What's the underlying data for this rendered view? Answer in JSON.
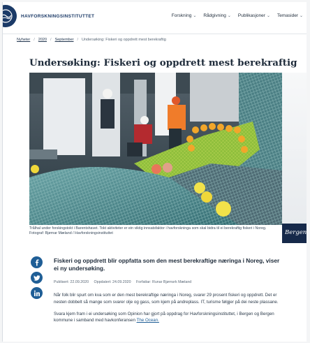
{
  "header": {
    "brand": "HAVFORSKNINGSINSTITUTTET",
    "nav": [
      {
        "label": "Forskning"
      },
      {
        "label": "Rådgivning"
      },
      {
        "label": "Publikasjoner"
      },
      {
        "label": "Temasider"
      }
    ]
  },
  "breadcrumb": {
    "items": [
      "Nyheter",
      "2020",
      "September"
    ],
    "current": "Undersøking: Fiskeri og oppdrett mest berekraftig"
  },
  "article": {
    "title": "Undersøking: Fiskeri og oppdrett mest berekraftig",
    "caption": "Trålhal under forskingstokt i Barentshavet. Tokt aktiviteter er ein viktig innsatsfaktor i havforskninga som skal bidra til ei berekraftig fiskeri i Noreg.",
    "photo_credit": "Fotograf: Bjørnar Mæland / Havforskningsinstituttet",
    "lead": "Fiskeri og oppdrett blir oppfatta som den mest berekraftige næringa i Noreg, viser ei ny undersøking.",
    "meta": {
      "published": "Publisert: 22.09.2020",
      "updated": "Oppdatert: 24.09.2020",
      "author": "Forfattar: Runar Bjørnsrk Mæland"
    },
    "paragraph1": "Når folk blir spurt om kva som er den mest berekraftige næringa i Noreg, svarer 29 prosent fiskeri og oppdrett. Det er nesten dobbelt så mange som svarer olje og gass, som kjem på andreplass. IT, turisme følgjer på dei neste plassane.",
    "paragraph2_prefix": "Svara kjem fram i ei undersøking som Opinion har gjort på oppdrag for Havforskningsinstituttet, i Bergen og Bergen kommune i samband med havkonferansen",
    "paragraph2_link": "The Ocean."
  },
  "sidebar": {
    "banner_text": "Bergen"
  },
  "social": [
    {
      "icon": "facebook-icon"
    },
    {
      "icon": "twitter-icon"
    },
    {
      "icon": "linkedin-icon"
    }
  ],
  "colors": {
    "brand": "#1b3a67",
    "social": "#1f5e96",
    "text": "#1e2b3a"
  }
}
